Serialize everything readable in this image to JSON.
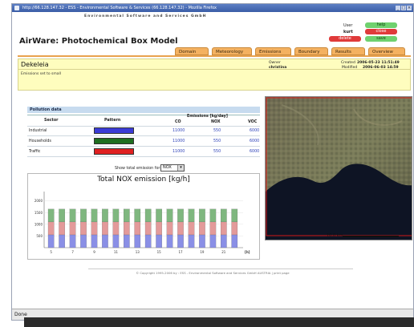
{
  "window": {
    "title": "http://66.128.147.32 - ESS - Environmental Software & Services (66.128.147.32) - Mozilla Firefox"
  },
  "header": {
    "banner": "Environmental Software and Services GmbH",
    "app_title": "AirWare: Photochemical Box Model",
    "user_label": "User",
    "user_name": "kurt"
  },
  "side_buttons": {
    "help": "help",
    "close": "close",
    "delete": "delete",
    "save": "save"
  },
  "tabs": [
    "Domain",
    "Meteorology",
    "Emissions",
    "Boundary",
    "Results",
    "Overview"
  ],
  "project": {
    "name": "Dekeleia",
    "description": "Emissions set to small",
    "owner_label": "Owner",
    "owner": "christina",
    "created_label": "Created",
    "created": "2006-05-23 11:51:49",
    "modified_label": "Modified",
    "modified": "2006-06-03 14:59"
  },
  "pollution": {
    "section_title": "Pollution data",
    "col_sector": "Sector",
    "col_pattern": "Pattern",
    "col_emissions": "Emissions [kg/day]",
    "col_co": "CO",
    "col_nox": "NOX",
    "col_voc": "VOC",
    "rows": [
      {
        "sector": "Industrial",
        "co": "11000",
        "nox": "550",
        "voc": "6000"
      },
      {
        "sector": "Households",
        "co": "11000",
        "nox": "550",
        "voc": "6000"
      },
      {
        "sector": "Traffic",
        "co": "11000",
        "nox": "550",
        "voc": "6000"
      }
    ]
  },
  "show_total": {
    "label": "Show total emission for:",
    "selected": "NOX"
  },
  "colors": {
    "industrial": "#3b3bd6",
    "households": "#1f6e1f",
    "traffic": "#e02020",
    "tab_bg": "#f4b160",
    "info_bg": "#fefdbe",
    "help_btn": "#6fd16f",
    "close_btn": "#e03a3a",
    "delete_btn": "#e03a3a",
    "save_btn": "#6fd16f"
  },
  "chart_data": {
    "type": "bar",
    "title": "Total NOX emission [kg/h]",
    "xlabel": "[h]",
    "ylabel": "",
    "x_ticks": [
      "5",
      "7",
      "9",
      "11",
      "13",
      "15",
      "17",
      "19",
      "21"
    ],
    "y_ticks": [
      "500",
      "1000",
      "1500",
      "2000"
    ],
    "ylim": [
      0,
      2400
    ],
    "categories": [
      "5",
      "6",
      "7",
      "8",
      "9",
      "10",
      "11",
      "12",
      "13",
      "14",
      "15",
      "16",
      "17",
      "18",
      "19",
      "20",
      "21",
      "22"
    ],
    "series": [
      {
        "values": [
          550,
          550,
          550,
          550,
          550,
          550,
          550,
          550,
          550,
          550,
          550,
          550,
          550,
          550,
          550,
          550,
          550,
          550
        ],
        "color": "#8a8fe6"
      },
      {
        "values": [
          550,
          550,
          550,
          550,
          550,
          550,
          550,
          550,
          550,
          550,
          550,
          550,
          550,
          550,
          550,
          550,
          550,
          550
        ],
        "color": "#e39a9a"
      },
      {
        "values": [
          550,
          550,
          550,
          550,
          550,
          550,
          550,
          550,
          550,
          550,
          550,
          550,
          550,
          550,
          550,
          550,
          550,
          550
        ],
        "color": "#7fb77f"
      }
    ]
  },
  "map": {
    "scale_label": "10.0 km"
  },
  "footer": {
    "text": "© Copyright 1995-2006 by : ESS - Environmental Software and Services GmbH AUSTRIA | print page"
  },
  "statusbar": {
    "text": "Done"
  }
}
